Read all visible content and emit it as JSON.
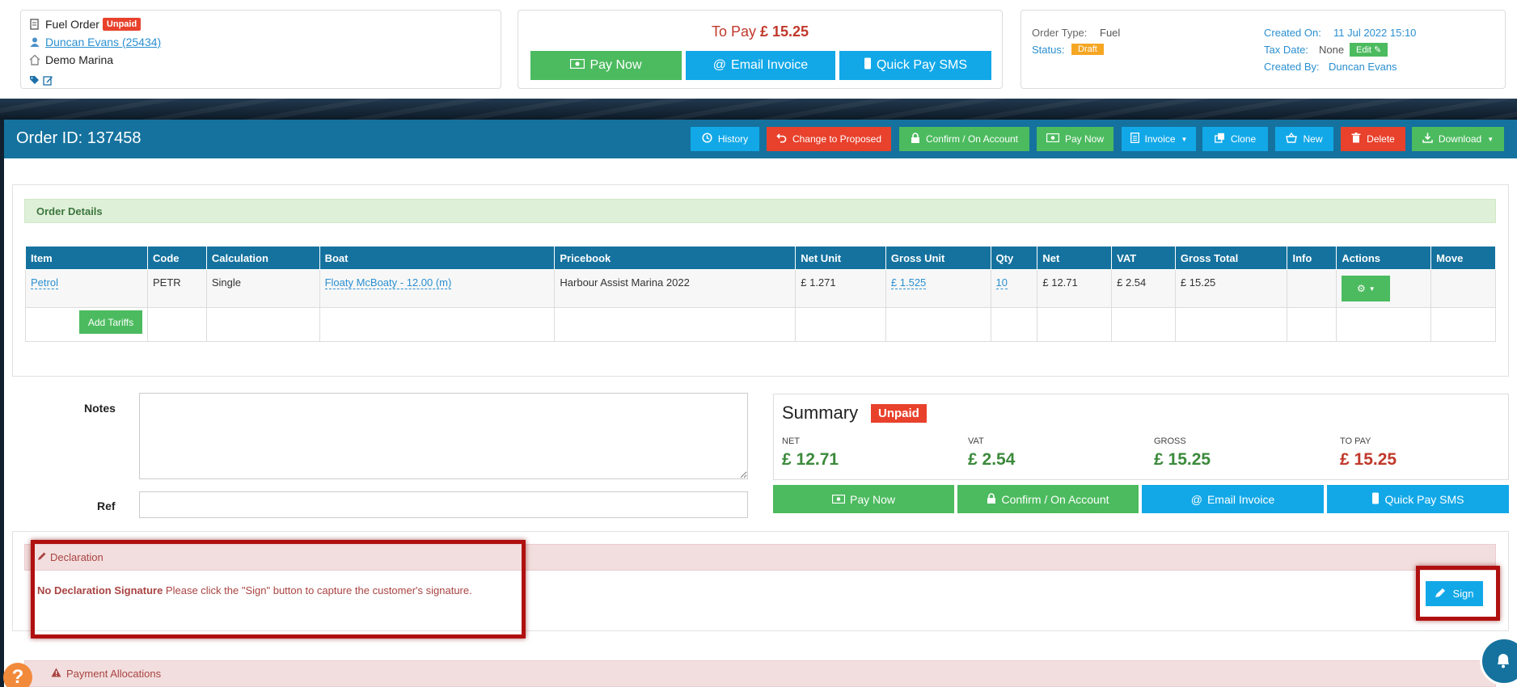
{
  "header": {
    "order_kind": "Fuel Order",
    "unpaid_badge": "Unpaid",
    "customer_link": " Duncan Evans (25434)",
    "marina": "Demo Marina"
  },
  "pay_card": {
    "to_pay_label": "To Pay",
    "to_pay_amount": "£ 15.25",
    "pay_now": "Pay Now",
    "email_invoice": "Email Invoice",
    "quick_pay_sms": "Quick Pay SMS"
  },
  "info_card": {
    "order_type_label": "Order Type:",
    "order_type_value": "Fuel",
    "status_label": "Status:",
    "status_value": "Draft",
    "created_on_label": "Created On:",
    "created_on_value": "11 Jul 2022 15:10",
    "tax_date_label": "Tax Date:",
    "tax_date_value": "None",
    "edit_label": "Edit",
    "created_by_label": "Created By:",
    "created_by_value": "Duncan Evans"
  },
  "order_bar": {
    "title": "Order ID: 137458",
    "buttons": [
      "History",
      "Change to Proposed",
      "Confirm / On Account",
      "Pay Now",
      "Invoice",
      "Clone",
      "New",
      "Delete",
      "Download"
    ]
  },
  "order_details": {
    "heading": "Order Details",
    "columns": [
      "Item",
      "Code",
      "Calculation",
      "Boat",
      "Pricebook",
      "Net Unit",
      "Gross Unit",
      "Qty",
      "Net",
      "VAT",
      "Gross Total",
      "Info",
      "Actions",
      "Move"
    ],
    "row": {
      "item": "Petrol",
      "code": "PETR",
      "calculation": "Single",
      "boat": "Floaty McBoaty - 12.00 (m)",
      "pricebook": "Harbour Assist Marina 2022",
      "net_unit": "£ 1.271",
      "gross_unit": "£ 1.525",
      "qty": "10",
      "net": "£ 12.71",
      "vat": "£ 2.54",
      "gross_total": "£ 15.25"
    },
    "add_tariffs": "Add Tariffs"
  },
  "form": {
    "notes_label": "Notes",
    "ref_label": "Ref"
  },
  "summary": {
    "title": "Summary",
    "badge": "Unpaid",
    "net_label": "NET",
    "net_value": "£ 12.71",
    "vat_label": "VAT",
    "vat_value": "£ 2.54",
    "gross_label": "GROSS",
    "gross_value": "£ 15.25",
    "to_pay_label": "TO PAY",
    "to_pay_value": "£ 15.25",
    "pay_now": "Pay Now",
    "confirm": "Confirm / On Account",
    "email_invoice": "Email Invoice",
    "quick_pay_sms": "Quick Pay SMS"
  },
  "declaration": {
    "heading": "Declaration",
    "bold": "No Declaration Signature",
    "message": " Please click the \"Sign\" button to capture the customer's signature.",
    "sign": "Sign"
  },
  "payment_allocations": {
    "heading": "Payment Allocations"
  },
  "colors": {
    "primary_bar": "#15729e",
    "green": "#4cbb5f",
    "blue": "#12a8e8",
    "red": "#e8412c",
    "orange": "#f5a623"
  }
}
